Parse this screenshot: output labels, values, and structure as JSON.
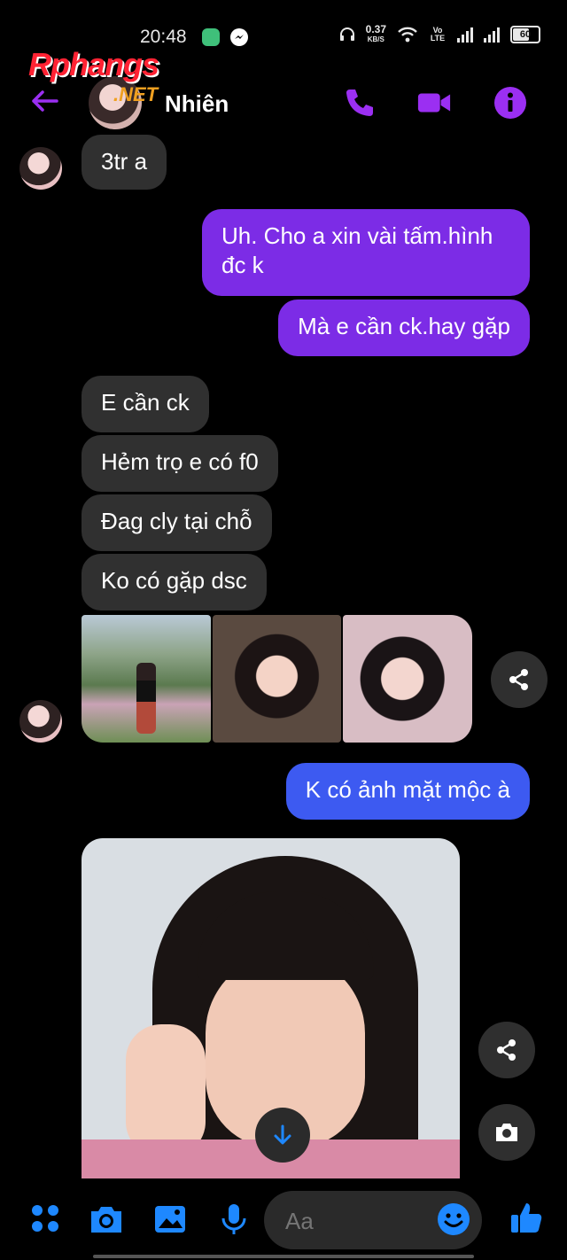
{
  "status": {
    "time": "20:48",
    "net_speed_value": "0.37",
    "net_speed_unit": "KB/S",
    "volte_label": "Vo LTE",
    "battery": "60"
  },
  "header": {
    "contact_name": "Nhiên",
    "watermark": "Rphangs",
    "watermark_sub": ".NET",
    "icons": [
      "back-arrow-icon",
      "phone-icon",
      "video-camera-icon",
      "info-icon"
    ]
  },
  "messages": [
    {
      "side": "in",
      "text": "3tr a"
    },
    {
      "side": "out",
      "text": "Uh. Cho a xin vài tấm.hình đc k"
    },
    {
      "side": "out",
      "text": "Mà e cần ck.hay gặp"
    },
    {
      "side": "in",
      "text": "E cần ck"
    },
    {
      "side": "in",
      "text": "Hẻm trọ e có f0"
    },
    {
      "side": "in",
      "text": "Đag cly tại chỗ"
    },
    {
      "side": "in",
      "text": "Ko có gặp dsc"
    },
    {
      "side": "out",
      "text": "K có ảnh mặt mộc à"
    }
  ],
  "composer": {
    "placeholder": "Aa",
    "icons": [
      "grid-menu-icon",
      "camera-icon",
      "gallery-icon",
      "microphone-icon",
      "emoji-icon",
      "thumbs-up-icon"
    ]
  },
  "colors": {
    "accent_purple": "#9b2ff2",
    "outgoing_bubble": "#7c2ce6",
    "outgoing_blue": "#3d5af1",
    "incoming_bubble": "#303030",
    "composer_icon_blue": "#1e88ff"
  }
}
